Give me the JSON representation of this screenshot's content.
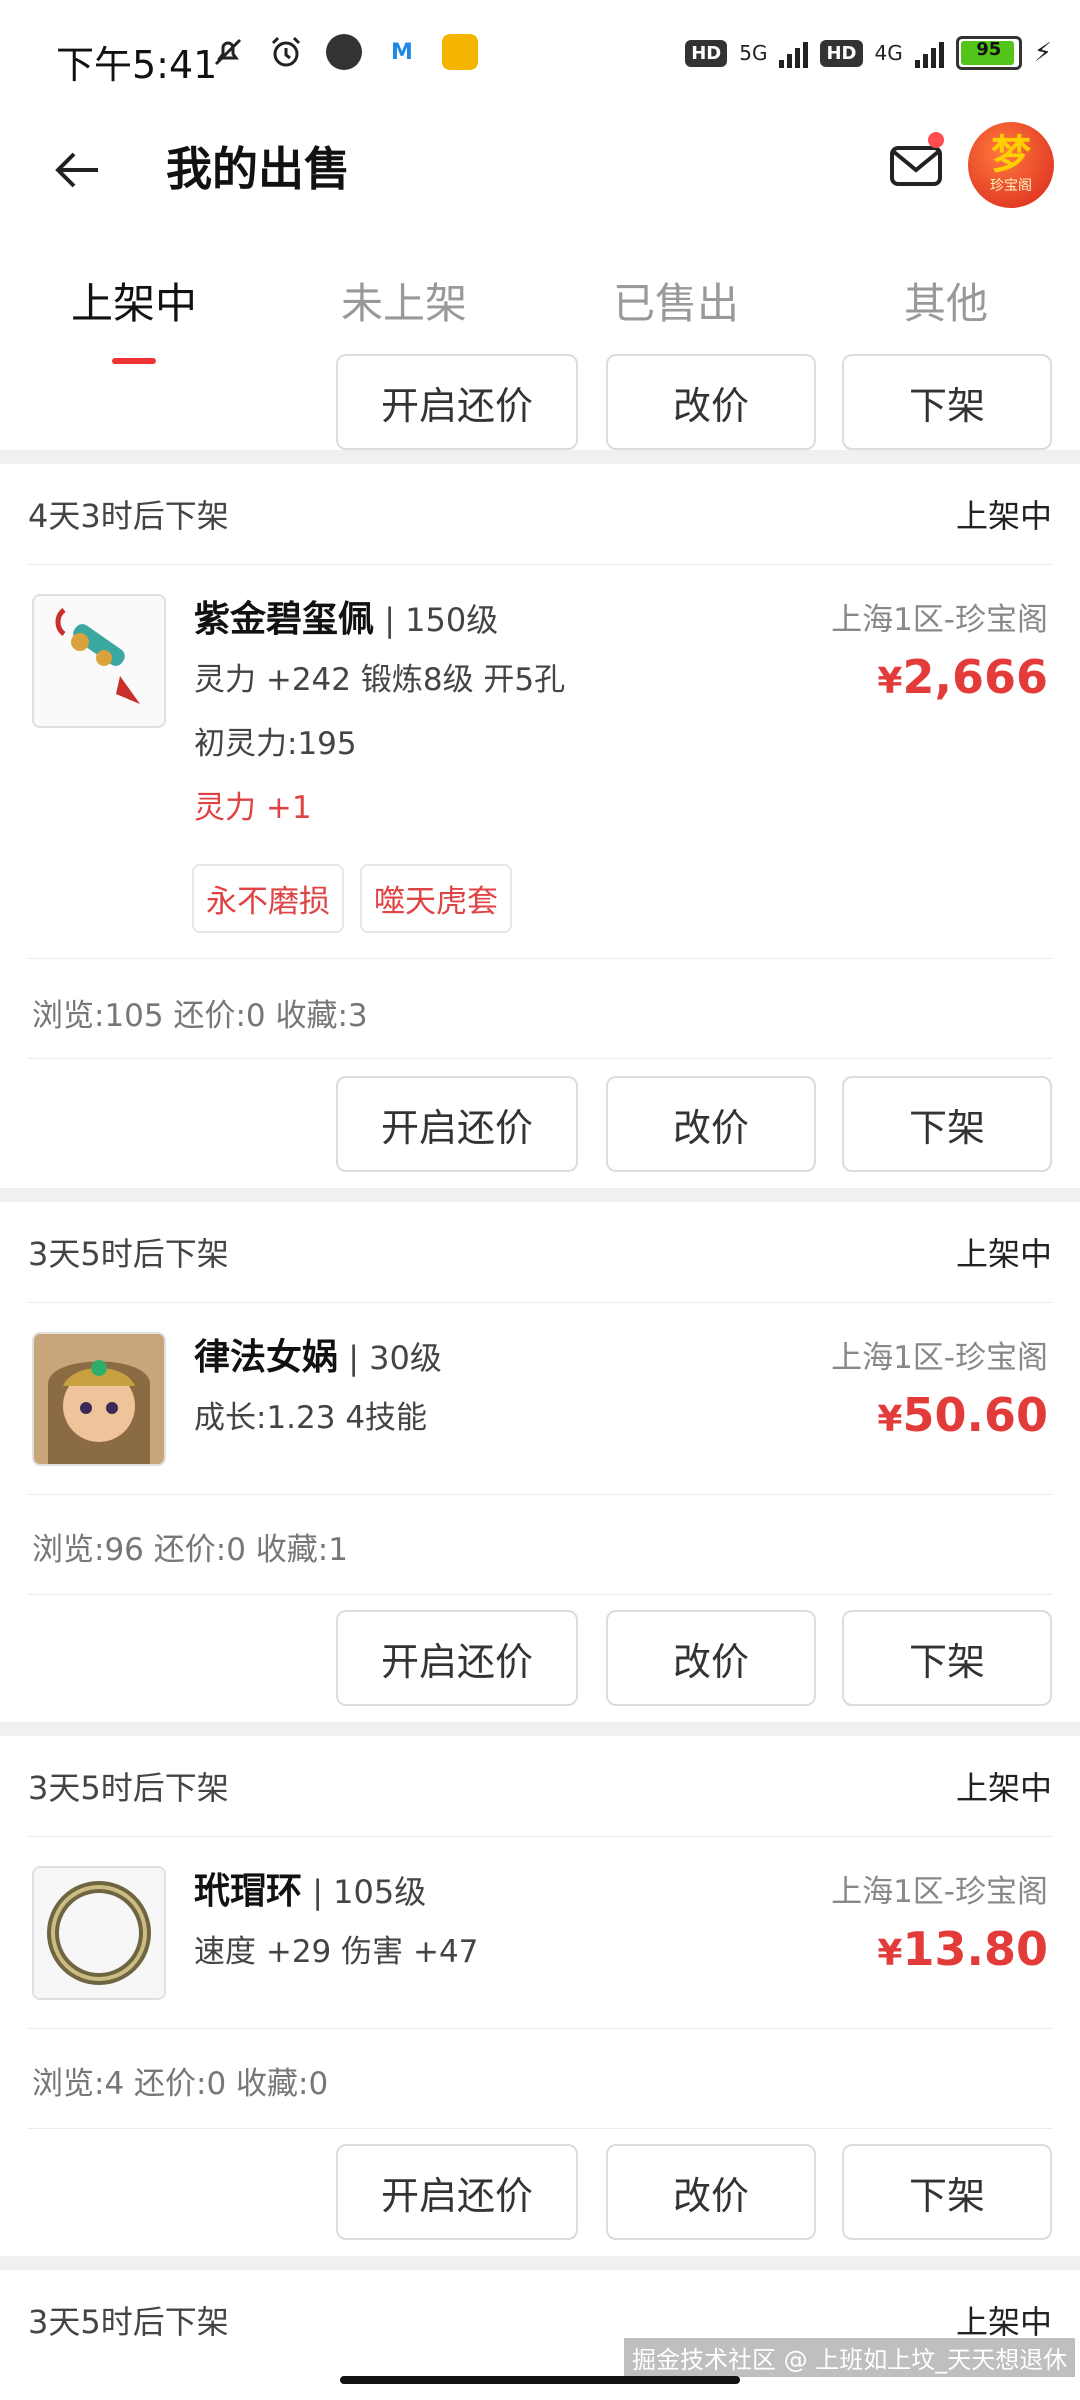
{
  "status": {
    "time": "下午5:41",
    "battery": "95",
    "net1": "5G",
    "net2": "4G",
    "hd": "HD"
  },
  "header": {
    "title": "我的出售"
  },
  "tabs": [
    {
      "label": "上架中"
    },
    {
      "label": "未上架"
    },
    {
      "label": "已售出"
    },
    {
      "label": "其他"
    }
  ],
  "buttons": {
    "counter": "开启还价",
    "reprice": "改价",
    "delist": "下架"
  },
  "avatar": {
    "big": "梦",
    "small": "珍宝阁"
  },
  "cards": [
    {
      "time_left": "4天3时后下架",
      "state": "上架中",
      "name": "紫金碧玺佩",
      "level": "150级",
      "lines": [
        "灵力 +242 锻炼8级 开5孔",
        "初灵力:195"
      ],
      "red_line": "灵力 +1",
      "tags": [
        "永不磨损",
        "噬天虎套"
      ],
      "server": "上海1区-珍宝阁",
      "price_symbol": "¥",
      "price": "2,666",
      "stats": "浏览:105 还价:0 收藏:3"
    },
    {
      "time_left": "3天5时后下架",
      "state": "上架中",
      "name": "律法女娲",
      "level": "30级",
      "lines": [
        "成长:1.23 4技能"
      ],
      "server": "上海1区-珍宝阁",
      "price_symbol": "¥",
      "price": "50.60",
      "stats": "浏览:96 还价:0 收藏:1"
    },
    {
      "time_left": "3天5时后下架",
      "state": "上架中",
      "name": "玳瑁环",
      "level": "105级",
      "lines": [
        "速度 +29 伤害 +47"
      ],
      "server": "上海1区-珍宝阁",
      "price_symbol": "¥",
      "price": "13.80",
      "stats": "浏览:4 还价:0 收藏:0"
    },
    {
      "time_left": "3天5时后下架",
      "state": "上架中"
    }
  ],
  "watermark": "掘金技术社区 @ 上班如上坟_天天想退休",
  "colors": {
    "accent": "#e33a3a",
    "tab_underline": "#e33333",
    "battery": "#52c41a"
  }
}
